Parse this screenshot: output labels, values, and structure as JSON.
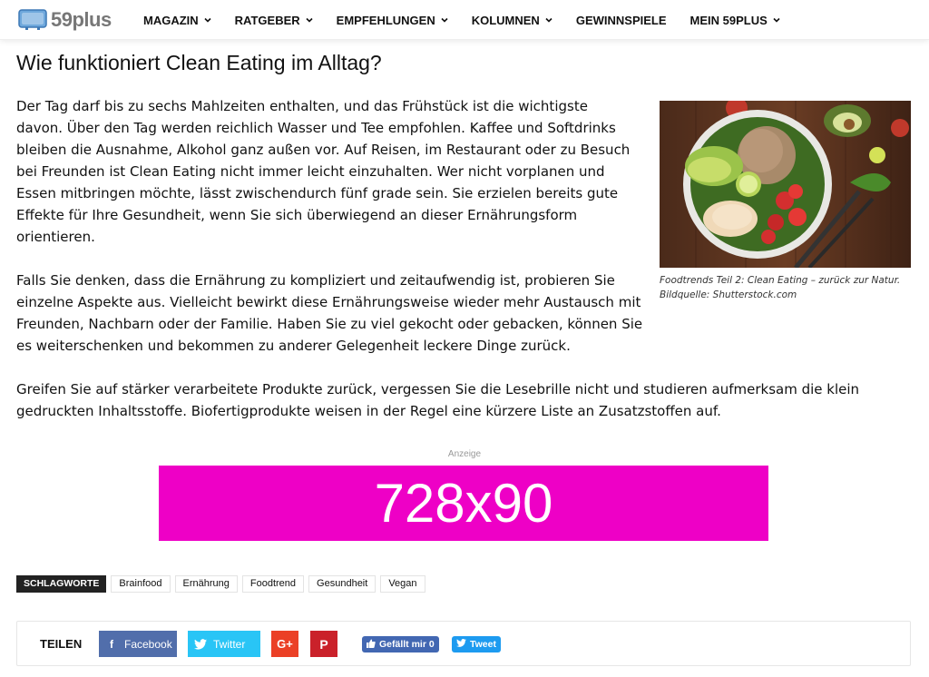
{
  "header": {
    "logo_text": "59plus",
    "nav": [
      {
        "label": "MAGAZIN",
        "has_dropdown": true
      },
      {
        "label": "RATGEBER",
        "has_dropdown": true
      },
      {
        "label": "EMPFEHLUNGEN",
        "has_dropdown": true
      },
      {
        "label": "KOLUMNEN",
        "has_dropdown": true
      },
      {
        "label": "GEWINNSPIELE",
        "has_dropdown": false
      },
      {
        "label": "MEIN 59PLUS",
        "has_dropdown": true
      }
    ]
  },
  "article": {
    "title": "Wie funktioniert Clean Eating im Alltag?",
    "paragraphs": [
      "Der Tag darf bis zu sechs Mahlzeiten enthalten, und das Frühstück ist die wichtigste davon. Über den Tag werden reichlich Wasser und Tee empfohlen. Kaffee und Softdrinks bleiben die Ausnahme, Alkohol ganz außen vor. Auf Reisen, im Restaurant oder zu Besuch bei Freunden ist Clean Eating nicht immer leicht einzuhalten. Wer nicht vorplanen und Essen mitbringen möchte, lässt zwischendurch fünf grade sein. Sie erzielen bereits gute Effekte für Ihre Gesundheit, wenn Sie sich überwiegend an dieser Ernährungsform orientieren.",
      "Falls Sie denken, dass die Ernährung zu kompliziert und zeitaufwendig ist, probieren Sie einzelne Aspekte aus. Vielleicht bewirkt diese Ernährungsweise wieder mehr Austausch mit Freunden, Nachbarn oder der Familie. Haben Sie zu viel gekocht oder gebacken, können Sie es weiterschenken und bekommen zu anderer Gelegenheit leckere Dinge zurück.",
      "Greifen Sie auf stärker verarbeitete Produkte zurück, vergessen Sie die Lesebrille nicht und studieren aufmerksam die klein gedruckten Inhaltsstoffe. Biofertigprodukte weisen in der Regel eine kürzere Liste an Zusatzstoffen auf."
    ],
    "figure": {
      "caption_line1": "Foodtrends Teil 2: Clean Eating – zurück zur Natur.",
      "caption_line2": "Bildquelle: Shutterstock.com"
    }
  },
  "ad": {
    "label": "Anzeige",
    "text": "728x90",
    "color": "#ee00c6"
  },
  "tags": {
    "heading": "SCHLAGWORTE",
    "items": [
      "Brainfood",
      "Ernährung",
      "Foodtrend",
      "Gesundheit",
      "Vegan"
    ]
  },
  "share": {
    "label": "TEILEN",
    "facebook": "Facebook",
    "twitter": "Twitter",
    "googleplus": "G+",
    "pinterest": "P",
    "like": "Gefällt mir 0",
    "tweet": "Tweet",
    "colors": {
      "facebook": "#516eab",
      "twitter": "#29c5f6",
      "googleplus": "#eb4026",
      "pinterest": "#ca212a"
    }
  }
}
